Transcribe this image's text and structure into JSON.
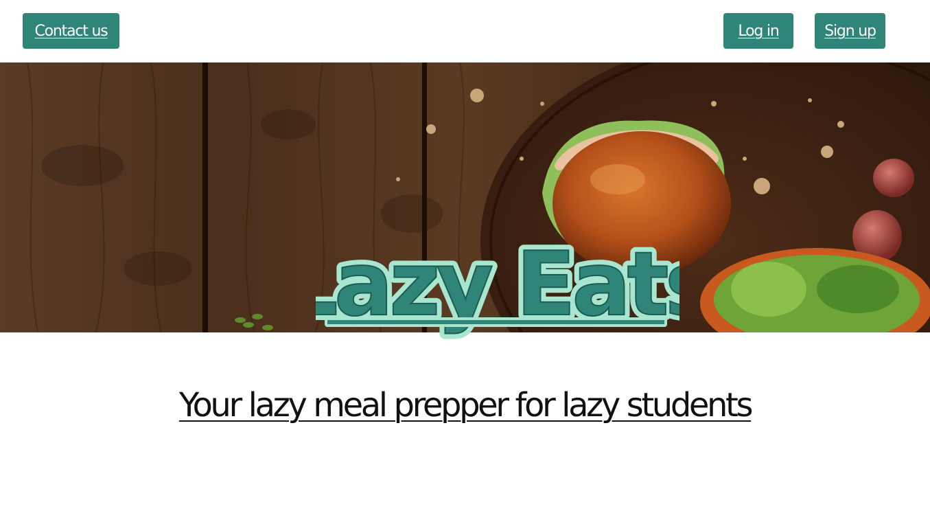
{
  "nav": {
    "contact_label": "Contact us",
    "login_label": "Log in",
    "signup_label": "Sign up"
  },
  "hero": {
    "image": "burger-on-wooden-table",
    "logo_text": "Lazy Eats"
  },
  "tagline": "Your lazy meal prepper for lazy students",
  "colors": {
    "accent": "#2f8577",
    "logo_fill": "#2f8577",
    "logo_outline": "#a8e6d0",
    "wood": "#4a2c1a"
  }
}
